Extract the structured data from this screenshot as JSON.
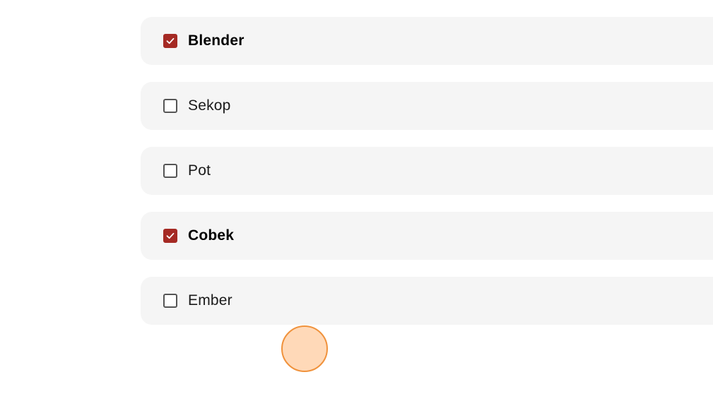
{
  "accent_color": "#a52a24",
  "options": [
    {
      "label": "Blender",
      "checked": true
    },
    {
      "label": "Sekop",
      "checked": false
    },
    {
      "label": "Pot",
      "checked": false
    },
    {
      "label": "Cobek",
      "checked": true
    },
    {
      "label": "Ember",
      "checked": false
    }
  ]
}
